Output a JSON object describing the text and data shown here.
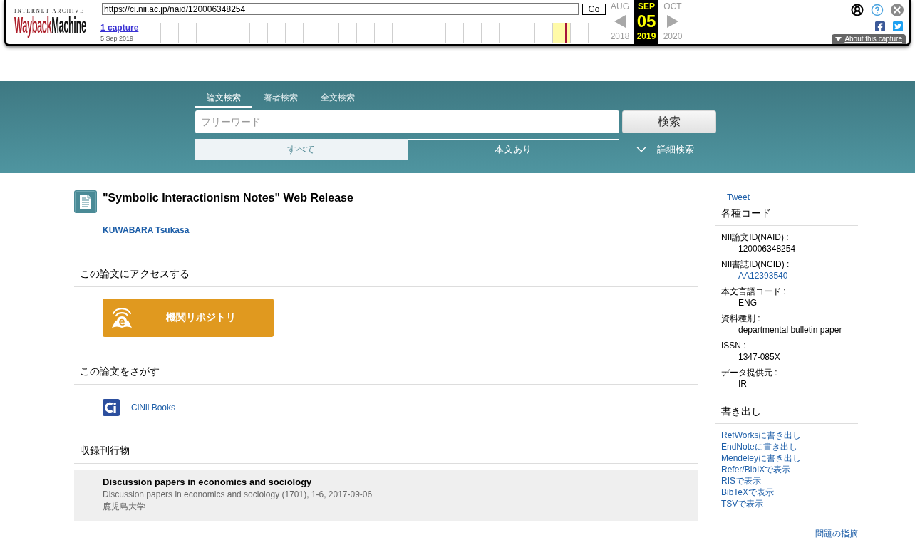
{
  "wayback": {
    "logo": {
      "caption": "INTERNET ARCHIVE",
      "wordmark": [
        "Wayback",
        "Machine"
      ]
    },
    "url": "https://ci.nii.ac.jp/naid/120006348254",
    "go_button": "Go",
    "captures_link": "1 capture",
    "capture_date": "5 Sep 2019",
    "calendar": [
      {
        "month": "AUG",
        "year": "2018",
        "selected": false
      },
      {
        "month": "SEP",
        "day": "05",
        "year": "2019",
        "selected": true
      },
      {
        "month": "OCT",
        "year": "2020",
        "selected": false
      }
    ],
    "about_button": "About this capture"
  },
  "search": {
    "tabs": [
      {
        "label": "論文検索",
        "selected": true
      },
      {
        "label": "著者検索",
        "selected": false
      },
      {
        "label": "全文検索",
        "selected": false
      }
    ],
    "placeholder": "フリーワード",
    "button": "検索",
    "filters": [
      {
        "label": "すべて",
        "selected": true
      },
      {
        "label": "本文あり",
        "selected": false
      }
    ],
    "advanced_link": "詳細検索"
  },
  "article": {
    "title": "\"Symbolic Interactionism Notes\" Web Release",
    "author": "KUWABARA Tsukasa",
    "sections": [
      {
        "kind": "repository",
        "heading": "この論文にアクセスする",
        "button": "機関リポジトリ"
      },
      {
        "kind": "links",
        "heading": "この論文をさがす",
        "links": [
          "CiNii Books"
        ]
      },
      {
        "kind": "publication",
        "heading": "収録刊行物",
        "title": "Discussion papers in economics and sociology",
        "detail": "Discussion papers in economics and sociology (1701), 1-6, 2017-09-06",
        "publisher": "鹿児島大学"
      }
    ]
  },
  "sidebar": {
    "tweet_link": "Tweet",
    "codes_heading": "各種コード",
    "codes": [
      {
        "label": "NII論文ID(NAID) :",
        "value": "120006348254",
        "link": false
      },
      {
        "label": "NII書誌ID(NCID) :",
        "value": "AA12393540",
        "link": true
      },
      {
        "label": "本文言語コード :",
        "value": "ENG",
        "link": false
      },
      {
        "label": "資料種別 :",
        "value": "departmental bulletin paper",
        "link": false
      },
      {
        "label": "ISSN :",
        "value": "1347-085X",
        "link": false
      },
      {
        "label": "データ提供元 :",
        "value": "IR",
        "link": false
      }
    ],
    "export_heading": "書き出し",
    "export_links": [
      "RefWorksに書き出し",
      "EndNoteに書き出し",
      "Mendeleyに書き出し",
      "Refer/BibIXで表示",
      "RISで表示",
      "BibTeXで表示",
      "TSVで表示"
    ],
    "report_link": "問題の指摘"
  }
}
